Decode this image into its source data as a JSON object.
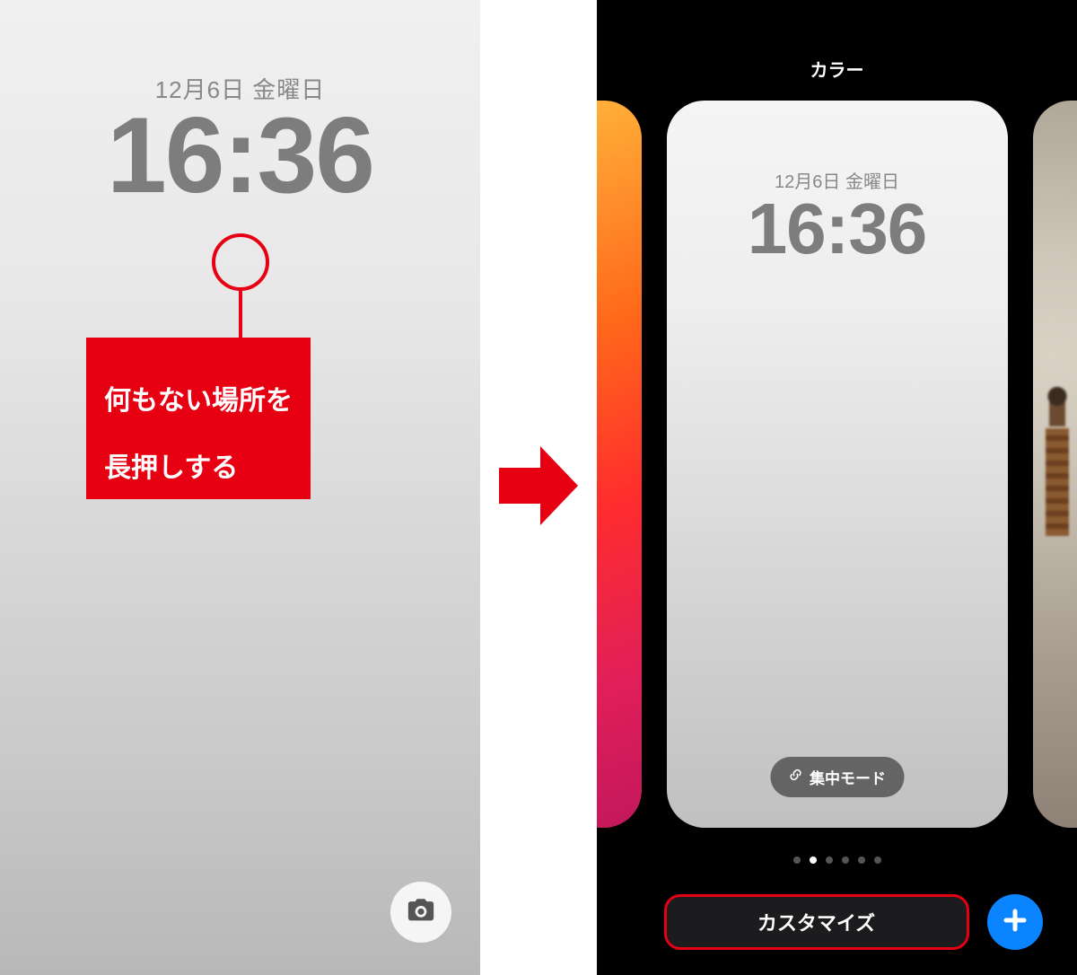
{
  "left": {
    "date": "12月6日 金曜日",
    "time": "16:36",
    "calloutLine1": "何もない場所を",
    "calloutLine2": "長押しする"
  },
  "right": {
    "galleryTitle": "カラー",
    "card": {
      "date": "12月6日 金曜日",
      "time": "16:36",
      "focusLabel": "集中モード"
    },
    "customizeLabel": "カスタマイズ",
    "pageDots": {
      "count": 6,
      "activeIndex": 1
    }
  },
  "colors": {
    "accentRed": "#e60012",
    "addBlue": "#0a84ff"
  }
}
